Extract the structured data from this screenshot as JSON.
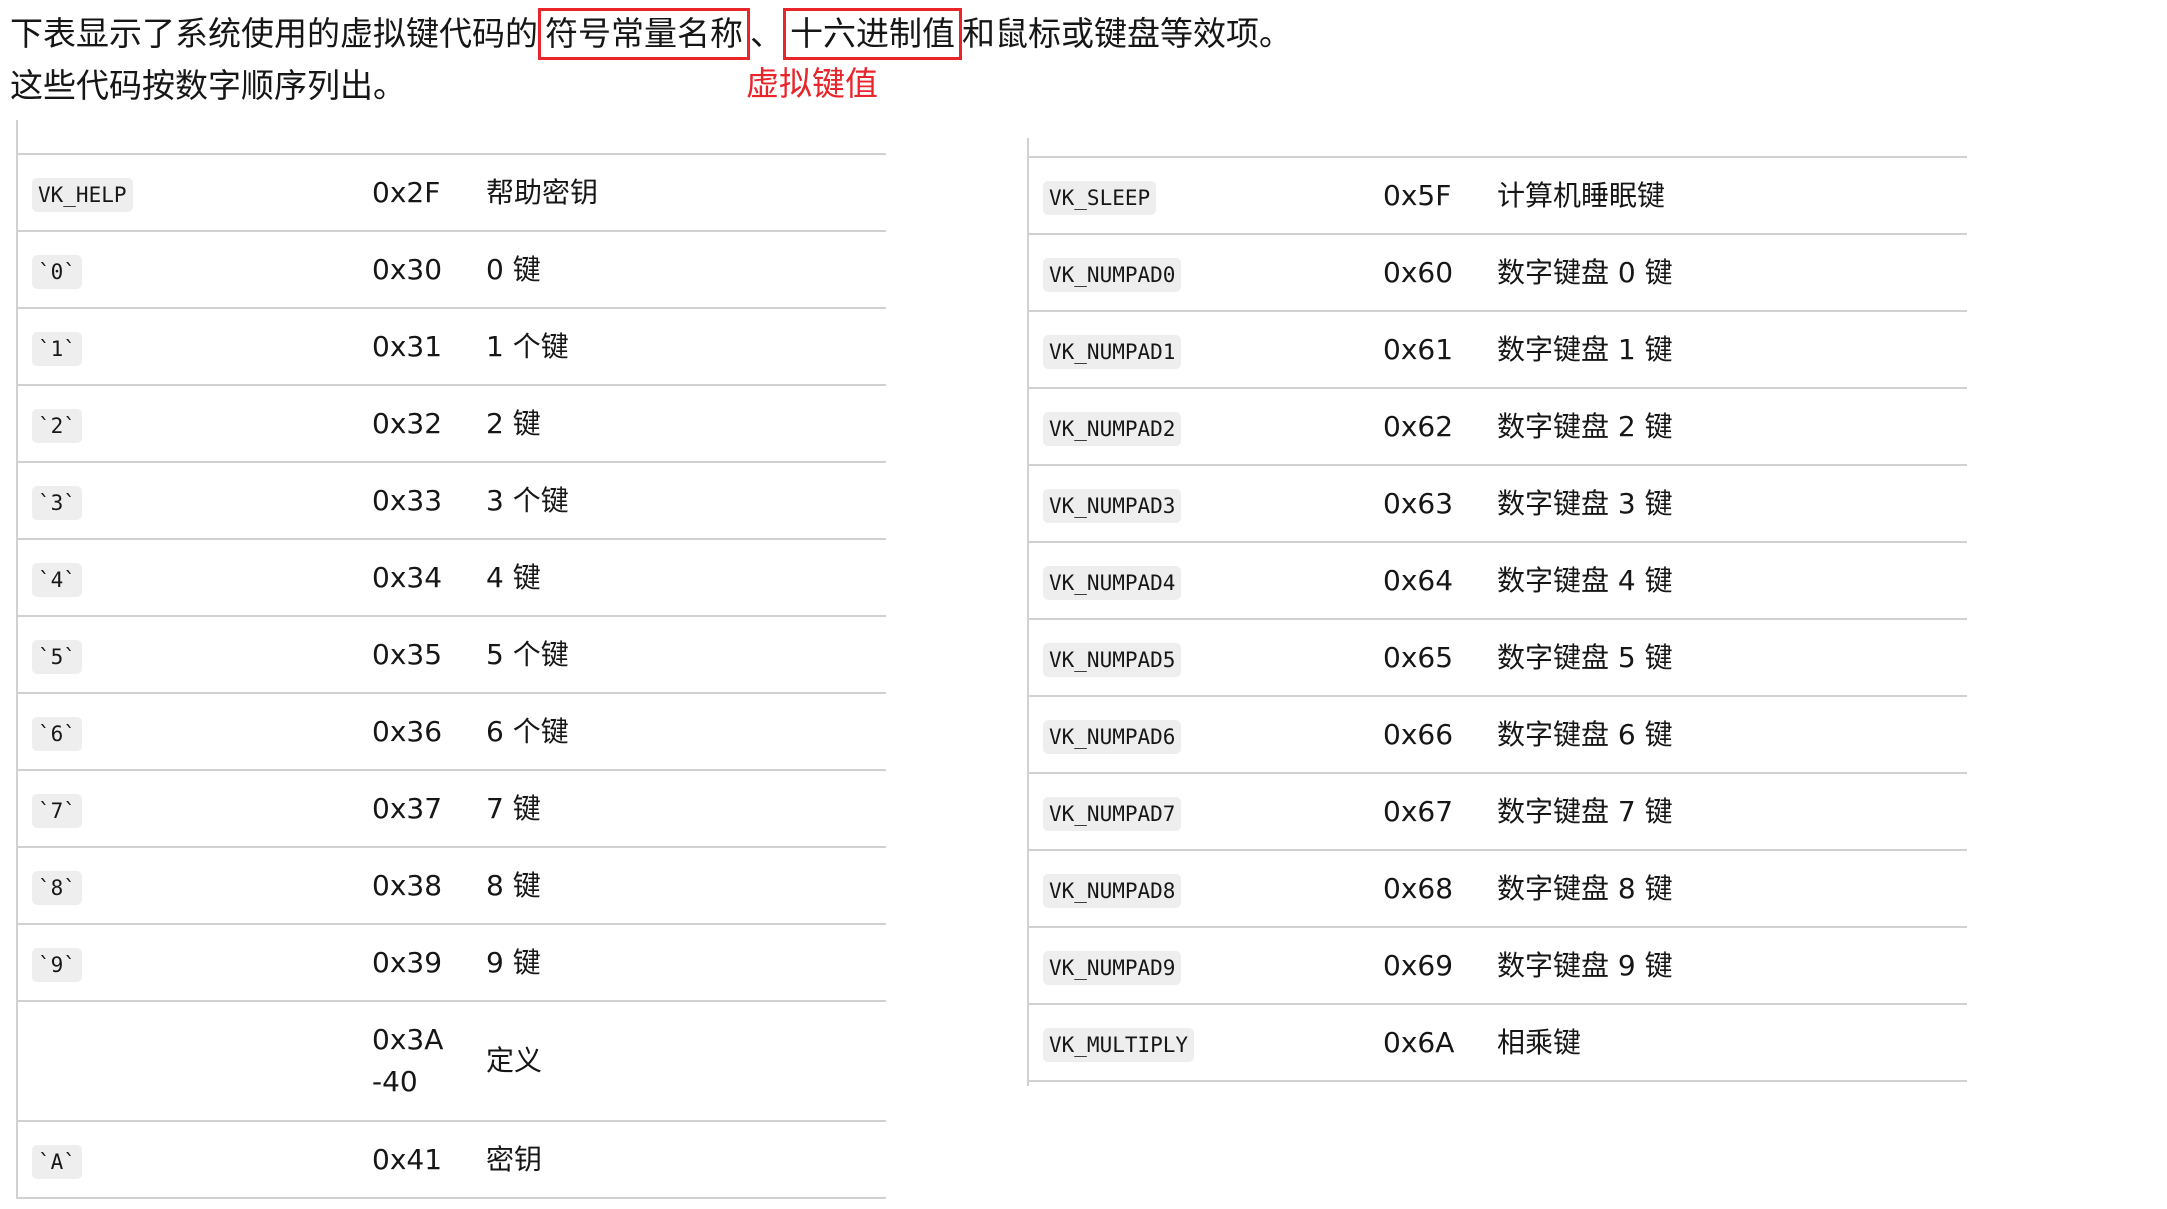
{
  "intro": {
    "part1": "下表显示了系统使用的虚拟键代码的",
    "boxed1": "符号常量名称",
    "sep": "、",
    "boxed2": "十六进制值",
    "part2": "和鼠标或键盘等效项。 这些代码按数字顺序列出。"
  },
  "annotation": "虚拟键值",
  "colors": {
    "highlight_red": "#e8252b",
    "code_bg": "#eeeeee",
    "row_border": "#d1d1d1"
  },
  "left_table": [
    {
      "name": "VK_HELP",
      "hex": "0x2F",
      "desc": "帮助密钥"
    },
    {
      "name": "`0`",
      "hex": "0x30",
      "desc": "0 键"
    },
    {
      "name": "`1`",
      "hex": "0x31",
      "desc": "1 个键"
    },
    {
      "name": "`2`",
      "hex": "0x32",
      "desc": "2 键"
    },
    {
      "name": "`3`",
      "hex": "0x33",
      "desc": "3 个键"
    },
    {
      "name": "`4`",
      "hex": "0x34",
      "desc": "4 键"
    },
    {
      "name": "`5`",
      "hex": "0x35",
      "desc": "5 个键"
    },
    {
      "name": "`6`",
      "hex": "0x36",
      "desc": "6 个键"
    },
    {
      "name": "`7`",
      "hex": "0x37",
      "desc": "7 键"
    },
    {
      "name": "`8`",
      "hex": "0x38",
      "desc": "8 键"
    },
    {
      "name": "`9`",
      "hex": "0x39",
      "desc": "9 键"
    },
    {
      "name": "",
      "hex": "0x3A-40",
      "desc": "定义"
    },
    {
      "name": "`A`",
      "hex": "0x41",
      "desc": "密钥"
    }
  ],
  "right_table": [
    {
      "name": "VK_SLEEP",
      "hex": "0x5F",
      "desc": "计算机睡眠键"
    },
    {
      "name": "VK_NUMPAD0",
      "hex": "0x60",
      "desc": "数字键盘 0 键"
    },
    {
      "name": "VK_NUMPAD1",
      "hex": "0x61",
      "desc": "数字键盘 1 键"
    },
    {
      "name": "VK_NUMPAD2",
      "hex": "0x62",
      "desc": "数字键盘 2 键"
    },
    {
      "name": "VK_NUMPAD3",
      "hex": "0x63",
      "desc": "数字键盘 3 键"
    },
    {
      "name": "VK_NUMPAD4",
      "hex": "0x64",
      "desc": "数字键盘 4 键"
    },
    {
      "name": "VK_NUMPAD5",
      "hex": "0x65",
      "desc": "数字键盘 5 键"
    },
    {
      "name": "VK_NUMPAD6",
      "hex": "0x66",
      "desc": "数字键盘 6 键"
    },
    {
      "name": "VK_NUMPAD7",
      "hex": "0x67",
      "desc": "数字键盘 7 键"
    },
    {
      "name": "VK_NUMPAD8",
      "hex": "0x68",
      "desc": "数字键盘 8 键"
    },
    {
      "name": "VK_NUMPAD9",
      "hex": "0x69",
      "desc": "数字键盘 9 键"
    },
    {
      "name": "VK_MULTIPLY",
      "hex": "0x6A",
      "desc": "相乘键"
    }
  ]
}
